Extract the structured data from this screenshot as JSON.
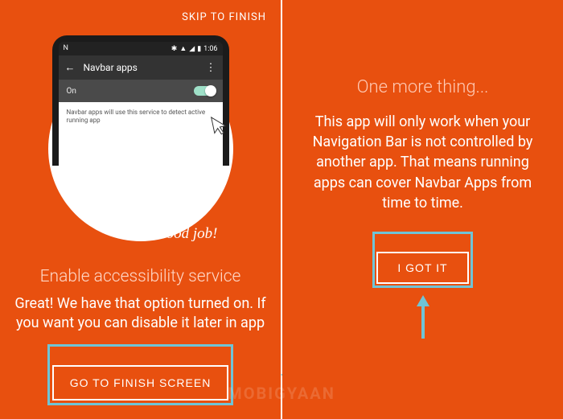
{
  "left": {
    "skip": "SKIP TO FINISH",
    "statusLeft": "N",
    "statusTime": "1:06",
    "appbarTitle": "Navbar apps",
    "toggleLabel": "On",
    "serviceDesc": "Navbar apps will use this service to detect active running app",
    "goodjob": "Good job!",
    "heading": "Enable accessibility service",
    "body": "Great! We have that option turned on. If you want you can disable it later in app",
    "cta": "GO TO FINISH SCREEN"
  },
  "right": {
    "heading": "One more thing...",
    "body": "This app will only work when your Navigation Bar is not controlled by another app. That means running apps can cover Navbar Apps from time to time.",
    "cta": "I GOT IT"
  },
  "watermark": "MOBIGYAAN",
  "colors": {
    "bg": "#e8500f",
    "highlight": "#6fc4d6"
  }
}
